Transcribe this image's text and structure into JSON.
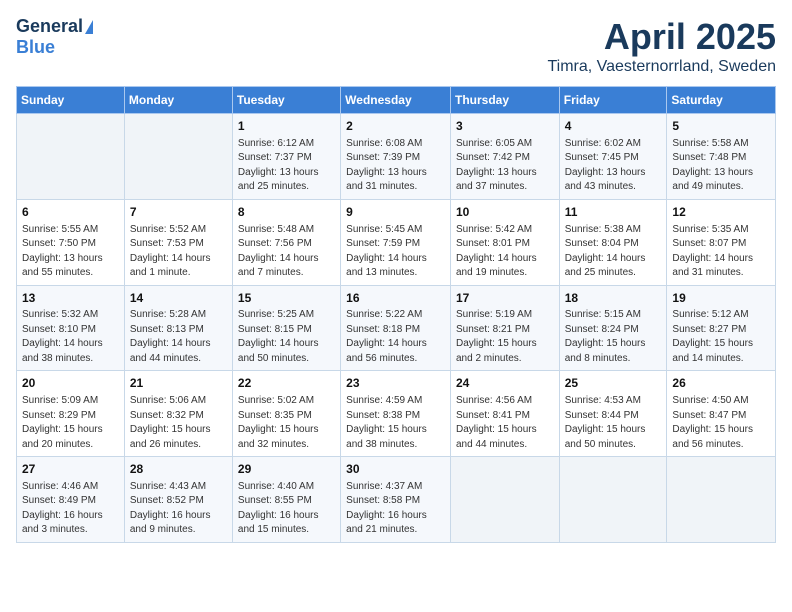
{
  "header": {
    "logo_general": "General",
    "logo_blue": "Blue",
    "month_title": "April 2025",
    "location": "Timra, Vaesternorrland, Sweden"
  },
  "weekdays": [
    "Sunday",
    "Monday",
    "Tuesday",
    "Wednesday",
    "Thursday",
    "Friday",
    "Saturday"
  ],
  "weeks": [
    [
      {
        "day": "",
        "detail": ""
      },
      {
        "day": "",
        "detail": ""
      },
      {
        "day": "1",
        "detail": "Sunrise: 6:12 AM\nSunset: 7:37 PM\nDaylight: 13 hours and 25 minutes."
      },
      {
        "day": "2",
        "detail": "Sunrise: 6:08 AM\nSunset: 7:39 PM\nDaylight: 13 hours and 31 minutes."
      },
      {
        "day": "3",
        "detail": "Sunrise: 6:05 AM\nSunset: 7:42 PM\nDaylight: 13 hours and 37 minutes."
      },
      {
        "day": "4",
        "detail": "Sunrise: 6:02 AM\nSunset: 7:45 PM\nDaylight: 13 hours and 43 minutes."
      },
      {
        "day": "5",
        "detail": "Sunrise: 5:58 AM\nSunset: 7:48 PM\nDaylight: 13 hours and 49 minutes."
      }
    ],
    [
      {
        "day": "6",
        "detail": "Sunrise: 5:55 AM\nSunset: 7:50 PM\nDaylight: 13 hours and 55 minutes."
      },
      {
        "day": "7",
        "detail": "Sunrise: 5:52 AM\nSunset: 7:53 PM\nDaylight: 14 hours and 1 minute."
      },
      {
        "day": "8",
        "detail": "Sunrise: 5:48 AM\nSunset: 7:56 PM\nDaylight: 14 hours and 7 minutes."
      },
      {
        "day": "9",
        "detail": "Sunrise: 5:45 AM\nSunset: 7:59 PM\nDaylight: 14 hours and 13 minutes."
      },
      {
        "day": "10",
        "detail": "Sunrise: 5:42 AM\nSunset: 8:01 PM\nDaylight: 14 hours and 19 minutes."
      },
      {
        "day": "11",
        "detail": "Sunrise: 5:38 AM\nSunset: 8:04 PM\nDaylight: 14 hours and 25 minutes."
      },
      {
        "day": "12",
        "detail": "Sunrise: 5:35 AM\nSunset: 8:07 PM\nDaylight: 14 hours and 31 minutes."
      }
    ],
    [
      {
        "day": "13",
        "detail": "Sunrise: 5:32 AM\nSunset: 8:10 PM\nDaylight: 14 hours and 38 minutes."
      },
      {
        "day": "14",
        "detail": "Sunrise: 5:28 AM\nSunset: 8:13 PM\nDaylight: 14 hours and 44 minutes."
      },
      {
        "day": "15",
        "detail": "Sunrise: 5:25 AM\nSunset: 8:15 PM\nDaylight: 14 hours and 50 minutes."
      },
      {
        "day": "16",
        "detail": "Sunrise: 5:22 AM\nSunset: 8:18 PM\nDaylight: 14 hours and 56 minutes."
      },
      {
        "day": "17",
        "detail": "Sunrise: 5:19 AM\nSunset: 8:21 PM\nDaylight: 15 hours and 2 minutes."
      },
      {
        "day": "18",
        "detail": "Sunrise: 5:15 AM\nSunset: 8:24 PM\nDaylight: 15 hours and 8 minutes."
      },
      {
        "day": "19",
        "detail": "Sunrise: 5:12 AM\nSunset: 8:27 PM\nDaylight: 15 hours and 14 minutes."
      }
    ],
    [
      {
        "day": "20",
        "detail": "Sunrise: 5:09 AM\nSunset: 8:29 PM\nDaylight: 15 hours and 20 minutes."
      },
      {
        "day": "21",
        "detail": "Sunrise: 5:06 AM\nSunset: 8:32 PM\nDaylight: 15 hours and 26 minutes."
      },
      {
        "day": "22",
        "detail": "Sunrise: 5:02 AM\nSunset: 8:35 PM\nDaylight: 15 hours and 32 minutes."
      },
      {
        "day": "23",
        "detail": "Sunrise: 4:59 AM\nSunset: 8:38 PM\nDaylight: 15 hours and 38 minutes."
      },
      {
        "day": "24",
        "detail": "Sunrise: 4:56 AM\nSunset: 8:41 PM\nDaylight: 15 hours and 44 minutes."
      },
      {
        "day": "25",
        "detail": "Sunrise: 4:53 AM\nSunset: 8:44 PM\nDaylight: 15 hours and 50 minutes."
      },
      {
        "day": "26",
        "detail": "Sunrise: 4:50 AM\nSunset: 8:47 PM\nDaylight: 15 hours and 56 minutes."
      }
    ],
    [
      {
        "day": "27",
        "detail": "Sunrise: 4:46 AM\nSunset: 8:49 PM\nDaylight: 16 hours and 3 minutes."
      },
      {
        "day": "28",
        "detail": "Sunrise: 4:43 AM\nSunset: 8:52 PM\nDaylight: 16 hours and 9 minutes."
      },
      {
        "day": "29",
        "detail": "Sunrise: 4:40 AM\nSunset: 8:55 PM\nDaylight: 16 hours and 15 minutes."
      },
      {
        "day": "30",
        "detail": "Sunrise: 4:37 AM\nSunset: 8:58 PM\nDaylight: 16 hours and 21 minutes."
      },
      {
        "day": "",
        "detail": ""
      },
      {
        "day": "",
        "detail": ""
      },
      {
        "day": "",
        "detail": ""
      }
    ]
  ]
}
